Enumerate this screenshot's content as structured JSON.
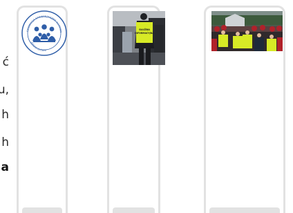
{
  "left_text": {
    "lines": [
      {
        "text": "ć",
        "bold": false
      },
      {
        "text": "u,",
        "bold": false
      },
      {
        "text": "h",
        "bold": false
      },
      {
        "text": "h",
        "bold": false
      },
      {
        "text": "a",
        "bold": true
      }
    ]
  },
  "cards": [
    {
      "image": "federation-logo",
      "logo_text": "FEDERACJA STOWARZYSZEŃ OCHRONY"
    },
    {
      "image": "security-officer-photo",
      "vest_text": "SŁUŻBA INFORMACYJNA"
    },
    {
      "image": "security-crowd-photo"
    }
  ],
  "colors": {
    "card_border": "#e2e2e2",
    "logo_blue": "#2f5ea8",
    "vest_yellow": "#d7ea26"
  }
}
